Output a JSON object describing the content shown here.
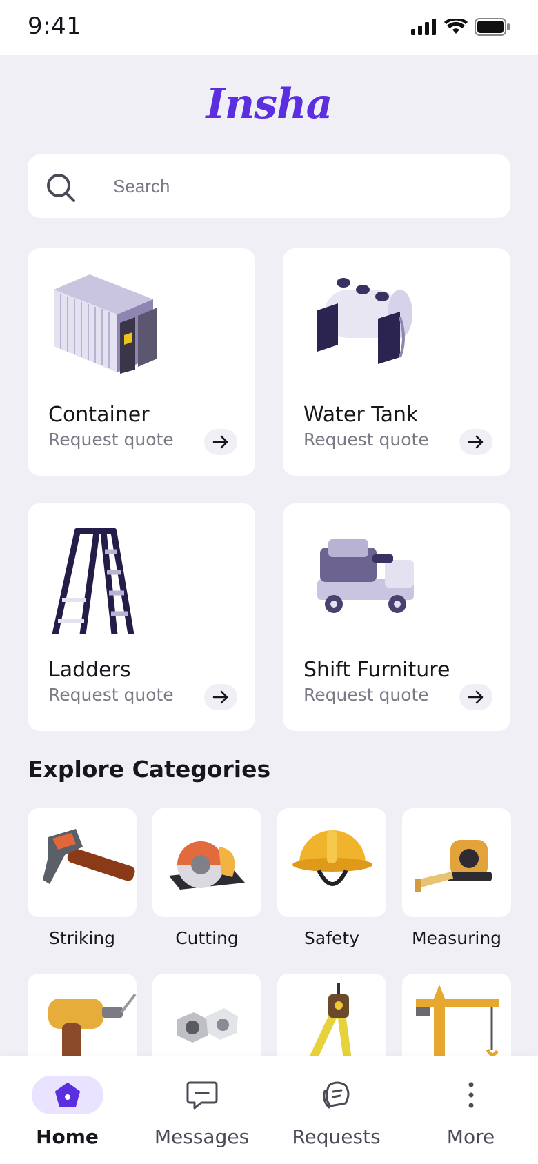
{
  "status_bar": {
    "time": "9:41"
  },
  "brand": {
    "name": "Insha",
    "color": "#5B2FE0"
  },
  "search": {
    "placeholder": "Search"
  },
  "services": [
    {
      "title": "Container",
      "subtitle": "Request quote",
      "icon": "shipping-container"
    },
    {
      "title": "Water Tank",
      "subtitle": "Request quote",
      "icon": "water-tank"
    },
    {
      "title": "Ladders",
      "subtitle": "Request quote",
      "icon": "ladder"
    },
    {
      "title": "Shift Furniture",
      "subtitle": "Request quote",
      "icon": "furniture-truck"
    }
  ],
  "explore": {
    "title": "Explore Categories",
    "categories": [
      {
        "label": "Striking",
        "icon": "hammer"
      },
      {
        "label": "Cutting",
        "icon": "circular-saw"
      },
      {
        "label": "Safety",
        "icon": "hard-hat"
      },
      {
        "label": "Measuring",
        "icon": "tape-measure"
      },
      {
        "label": "",
        "icon": "power-drill"
      },
      {
        "label": "",
        "icon": "nuts-bolts"
      },
      {
        "label": "",
        "icon": "compass"
      },
      {
        "label": "",
        "icon": "crane"
      }
    ]
  },
  "tab_bar": {
    "tabs": [
      {
        "label": "Home",
        "icon": "home-icon",
        "active": true
      },
      {
        "label": "Messages",
        "icon": "message-icon",
        "active": false
      },
      {
        "label": "Requests",
        "icon": "requests-icon",
        "active": false
      },
      {
        "label": "More",
        "icon": "more-icon",
        "active": false
      }
    ]
  }
}
